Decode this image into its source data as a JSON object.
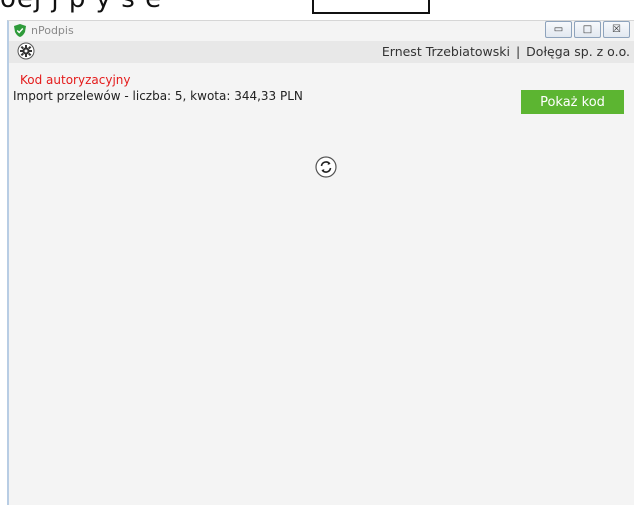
{
  "document_strip": {
    "text": "oej      j  p    y  s  e"
  },
  "window": {
    "title": "nPodpis",
    "controls": {
      "minimize": "▭",
      "maximize": "□",
      "close": "☒"
    }
  },
  "userbar": {
    "user_name": "Ernest Trzebiatowski",
    "separator": "|",
    "company": "Dołęga sp. z o.o."
  },
  "auth": {
    "title": "Kod autoryzacyjny",
    "description": "Import przelewów - liczba: 5, kwota: 344,33 PLN",
    "show_code_label": "Pokaż kod"
  },
  "colors": {
    "accent": "#5cb531",
    "alert": "#e41b1b",
    "shield": "#2e9b3a"
  },
  "icons": [
    "app-shield-icon",
    "gear-icon",
    "refresh-icon"
  ]
}
